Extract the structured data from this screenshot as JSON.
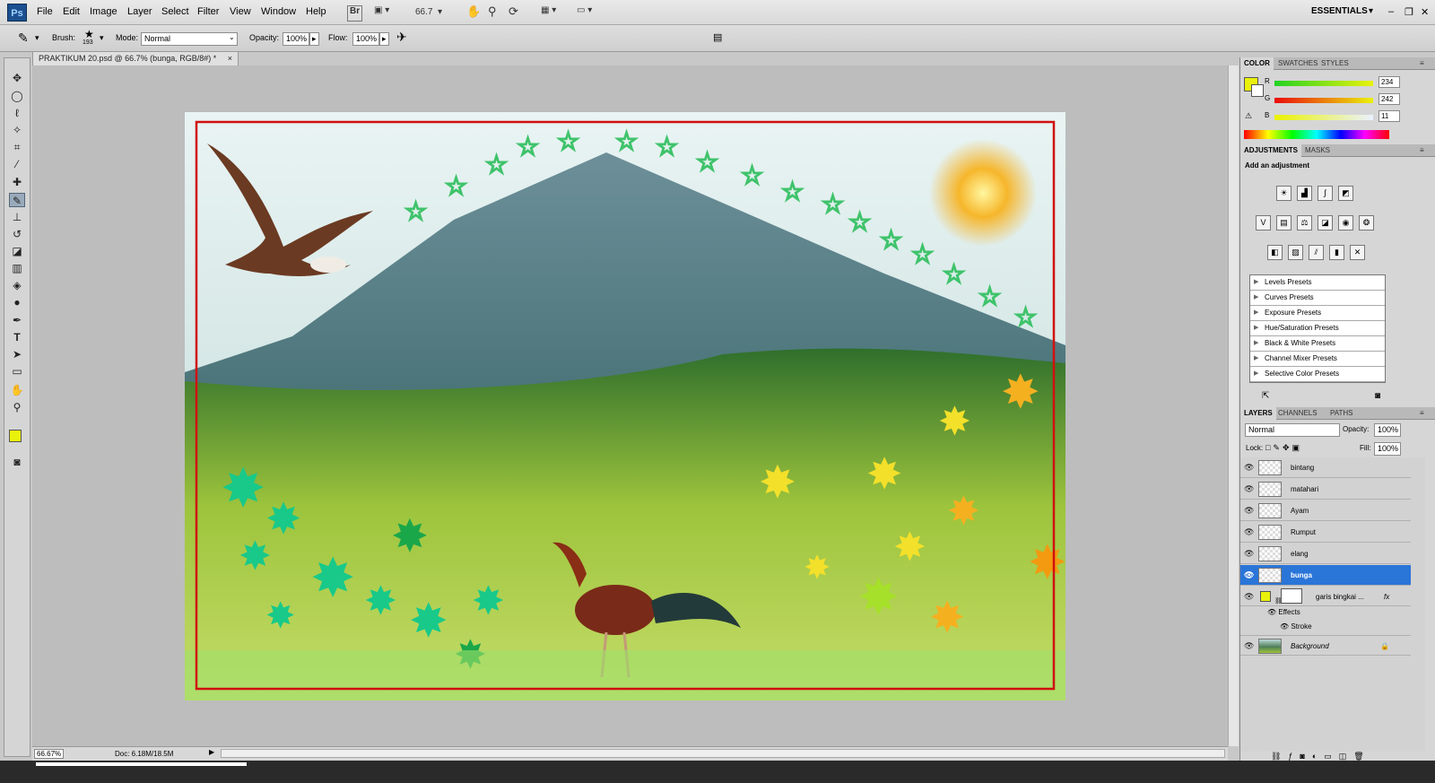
{
  "app": {
    "logo": "Ps",
    "workspace": "ESSENTIALS"
  },
  "menu": [
    "File",
    "Edit",
    "Image",
    "Layer",
    "Select",
    "Filter",
    "View",
    "Window",
    "Help"
  ],
  "menu_tools": {
    "bridge": "Br",
    "zoom": "66.7"
  },
  "options": {
    "brush_label": "Brush:",
    "brush_size": "193",
    "mode_label": "Mode:",
    "mode_value": "Normal",
    "opacity_label": "Opacity:",
    "opacity_value": "100%",
    "flow_label": "Flow:",
    "flow_value": "100%"
  },
  "document": {
    "tab_title": "PRAKTIKUM 20.psd @ 66.7% (bunga, RGB/8#) *",
    "close": "×"
  },
  "status": {
    "zoom": "66.67%",
    "doc": "Doc: 6.18M/18.5M"
  },
  "color_panel": {
    "tabs": [
      "COLOR",
      "SWATCHES",
      "STYLES"
    ],
    "foreground": "#eaf20b",
    "r_label": "R",
    "r": "234",
    "g_label": "G",
    "g": "242",
    "b_label": "B",
    "b": "11"
  },
  "adjustments": {
    "tabs": [
      "ADJUSTMENTS",
      "MASKS"
    ],
    "heading": "Add an adjustment",
    "presets": [
      "Levels Presets",
      "Curves Presets",
      "Exposure Presets",
      "Hue/Saturation Presets",
      "Black & White Presets",
      "Channel Mixer Presets",
      "Selective Color Presets"
    ]
  },
  "layers": {
    "tabs": [
      "LAYERS",
      "CHANNELS",
      "PATHS"
    ],
    "blend": "Normal",
    "opacity_label": "Opacity:",
    "opacity": "100%",
    "lock_label": "Lock:",
    "fill_label": "Fill:",
    "fill": "100%",
    "items": [
      "bintang",
      "matahari",
      "Ayam",
      "Rumput",
      "elang",
      "bunga"
    ],
    "selected": "bunga",
    "frame_layer": "garis bingkai ...",
    "effects": "Effects",
    "stroke": "Stroke",
    "background": "Background",
    "fx": "fx"
  },
  "colors": {
    "accent": "#2a75d8",
    "frame": "#d01010"
  }
}
